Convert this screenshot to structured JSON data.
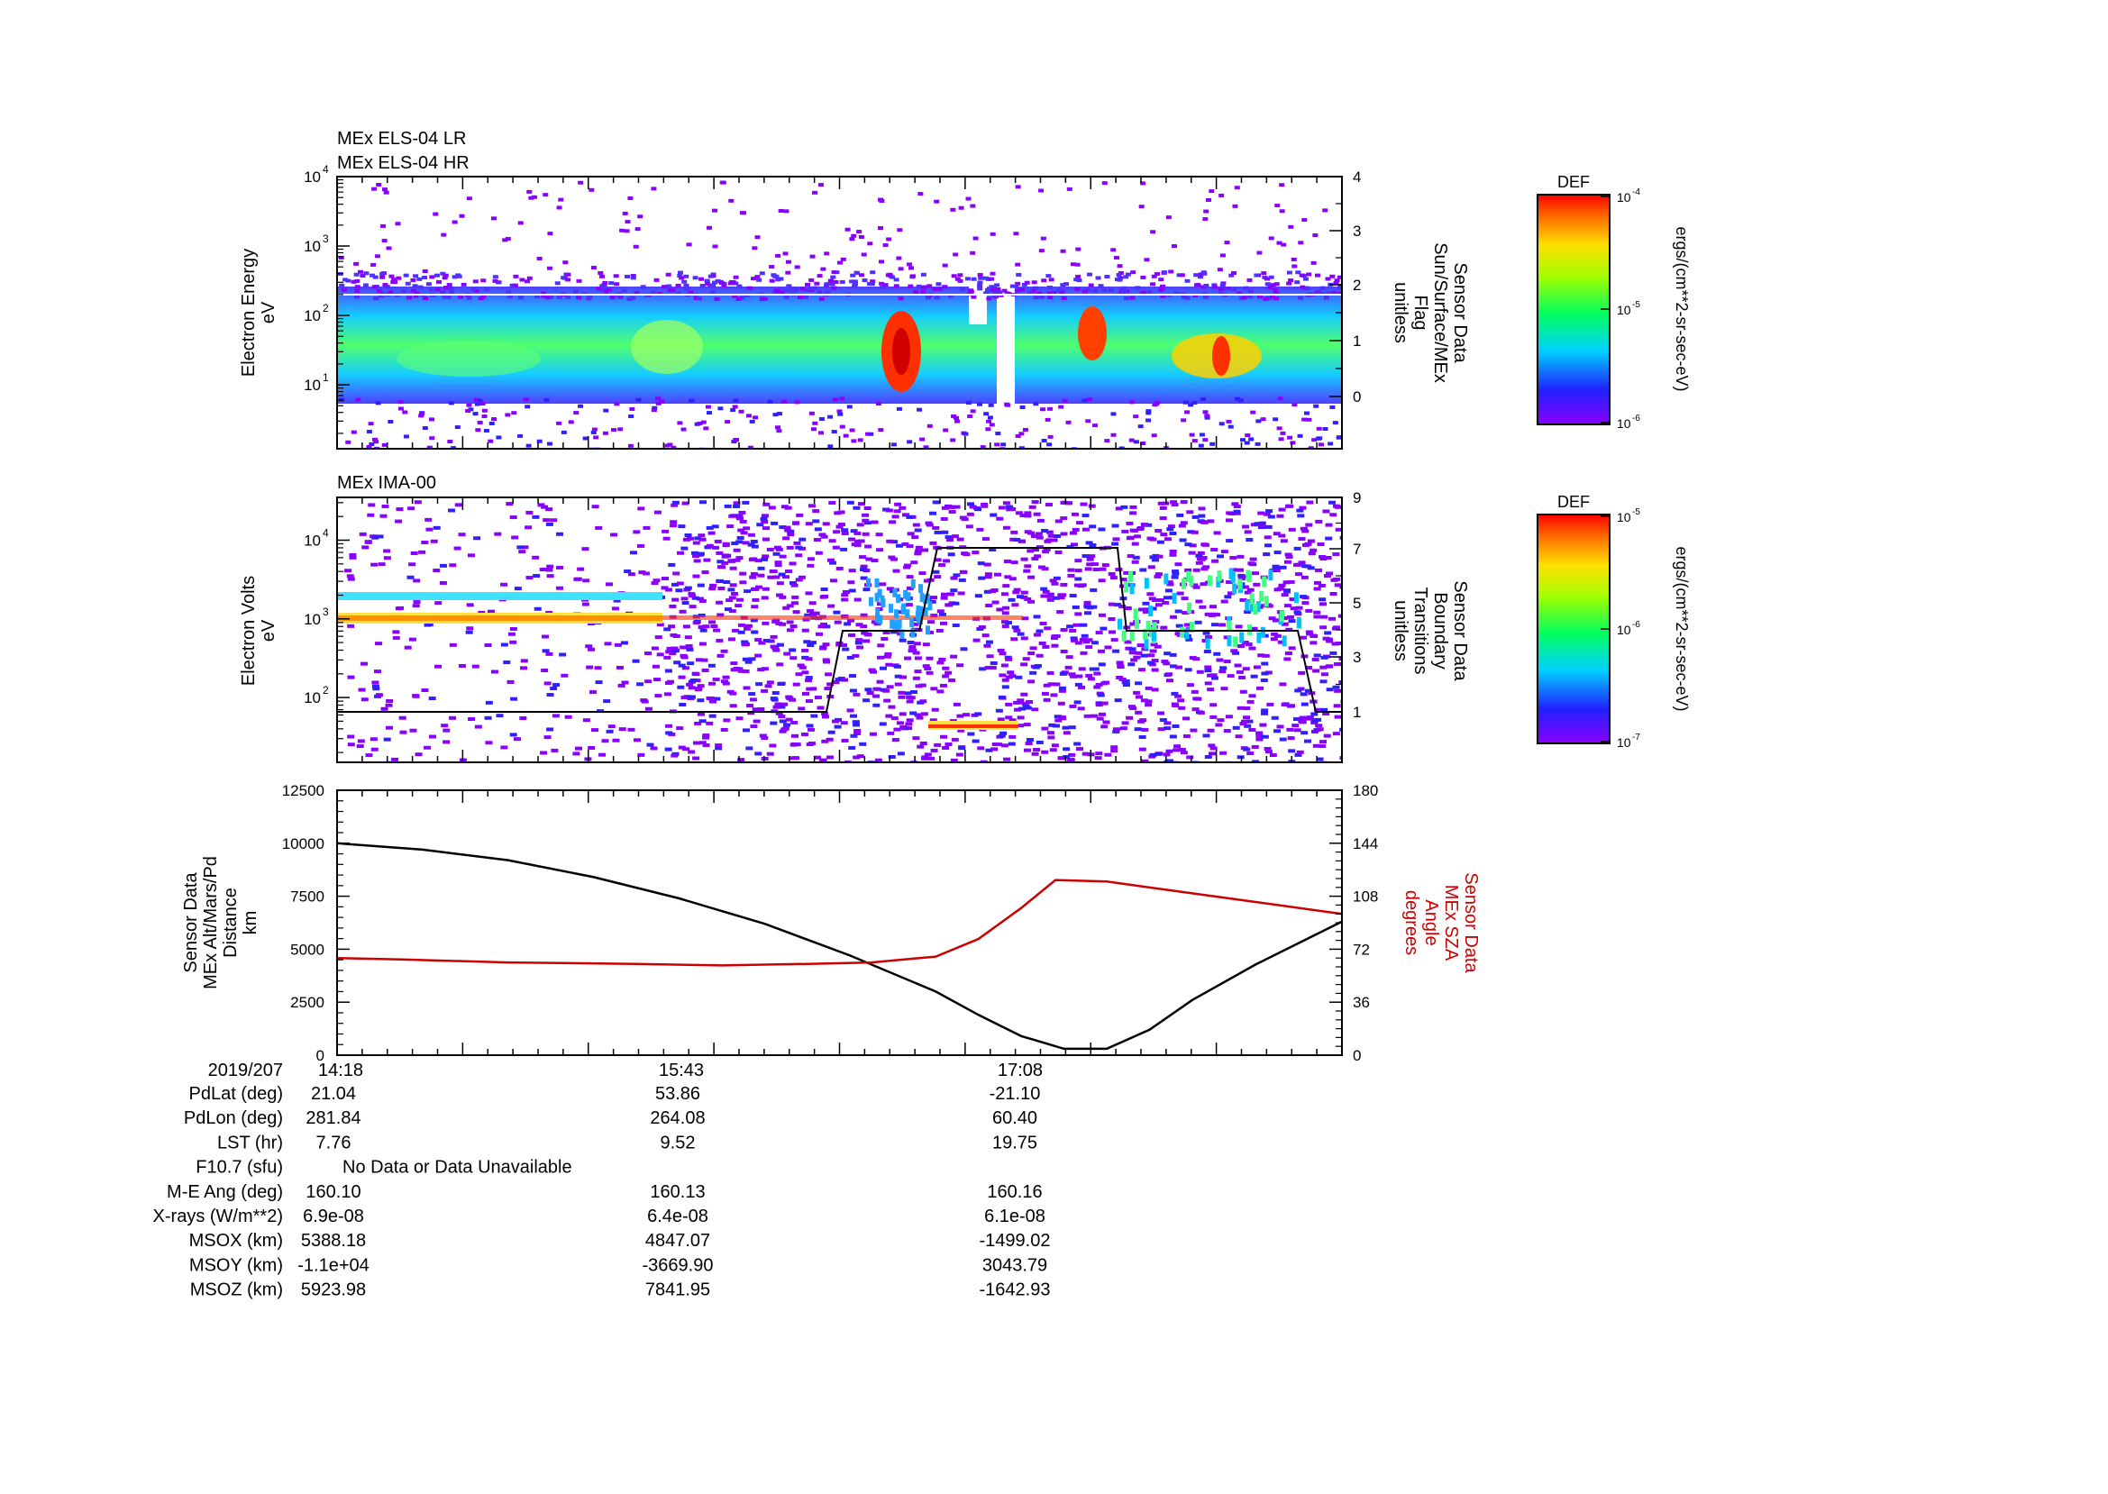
{
  "panel1": {
    "titles": [
      "MEx ELS-04 LR",
      "MEx ELS-04 HR"
    ],
    "ylabel_left": [
      "Electron Energy",
      "eV"
    ],
    "ylabel_right": [
      "Sensor Data",
      "Sun/Surface/MEx",
      "Flag",
      "unitless"
    ],
    "left_ticks": [
      {
        "label": "10",
        "exp": "1",
        "value": 10
      },
      {
        "label": "10",
        "exp": "2",
        "value": 100
      },
      {
        "label": "10",
        "exp": "3",
        "value": 1000
      },
      {
        "label": "10",
        "exp": "4",
        "value": 10000
      }
    ],
    "right_ticks": [
      "0",
      "1",
      "2",
      "3",
      "4"
    ],
    "colorbar": {
      "title": "DEF",
      "unit": "ergs/(cm**2-sr-sec-eV)",
      "ticks": [
        {
          "label": "10",
          "exp": "-4"
        },
        {
          "label": "10",
          "exp": "-5"
        },
        {
          "label": "10",
          "exp": "-6"
        }
      ]
    }
  },
  "panel2": {
    "titles": [
      "MEx IMA-00"
    ],
    "ylabel_left": [
      "Electron Volts",
      "eV"
    ],
    "ylabel_right": [
      "Sensor Data",
      "Boundary",
      "Transitions",
      "unitless"
    ],
    "left_ticks": [
      {
        "label": "10",
        "exp": "2",
        "value": 100
      },
      {
        "label": "10",
        "exp": "3",
        "value": 1000
      },
      {
        "label": "10",
        "exp": "4",
        "value": 10000
      }
    ],
    "right_ticks": [
      "1",
      "3",
      "5",
      "7",
      "9"
    ],
    "colorbar": {
      "title": "DEF",
      "unit": "ergs/(cm**2-sr-sec-eV)",
      "ticks": [
        {
          "label": "10",
          "exp": "-5"
        },
        {
          "label": "10",
          "exp": "-6"
        },
        {
          "label": "10",
          "exp": "-7"
        }
      ]
    }
  },
  "panel3": {
    "ylabel_left": [
      "Sensor Data",
      "MEx Alt/Mars/Pd",
      "Distance",
      "km"
    ],
    "ylabel_right": [
      "Sensor Data",
      "MEx SZA",
      "Angle",
      "degrees"
    ],
    "left_ticks": [
      "0",
      "2500",
      "5000",
      "7500",
      "10000",
      "12500"
    ],
    "right_ticks": [
      "0",
      "36",
      "72",
      "108",
      "144",
      "180"
    ],
    "right_color": "#cc0000"
  },
  "chart_data": {
    "type": "line",
    "x_unit": "minutes after 14:18",
    "xlim": [
      0,
      235
    ],
    "series": [
      {
        "axis": "left",
        "color": "#000000",
        "ylim": [
          0,
          12500
        ],
        "x": [
          0,
          20,
          40,
          60,
          80,
          100,
          120,
          140,
          150,
          160,
          170,
          180,
          190,
          200,
          215,
          235
        ],
        "y": [
          10000,
          9700,
          9200,
          8400,
          7400,
          6200,
          4700,
          3000,
          1900,
          900,
          300,
          300,
          1200,
          2600,
          4300,
          6300
        ]
      },
      {
        "axis": "right",
        "color": "#cc0000",
        "ylim": [
          0,
          180
        ],
        "x": [
          0,
          15,
          40,
          70,
          90,
          110,
          125,
          140,
          150,
          160,
          168,
          180,
          195,
          215,
          235
        ],
        "y": [
          66,
          65,
          63,
          62,
          61,
          62,
          63,
          67,
          79,
          100,
          119,
          118,
          112,
          104,
          96
        ]
      }
    ]
  },
  "time_labels": [
    "14:18",
    "15:43",
    "17:08"
  ],
  "ephemeris": {
    "date": "2019/207",
    "rows": [
      {
        "label": "PdLat (deg)",
        "values": [
          "21.04",
          "53.86",
          "-21.10"
        ]
      },
      {
        "label": "PdLon (deg)",
        "values": [
          "281.84",
          "264.08",
          "60.40"
        ]
      },
      {
        "label": "LST (hr)",
        "values": [
          "7.76",
          "9.52",
          "19.75"
        ]
      },
      {
        "label": "F10.7 (sfu)",
        "note": "No Data or Data Unavailable"
      },
      {
        "label": "M-E Ang (deg)",
        "values": [
          "160.10",
          "160.13",
          "160.16"
        ]
      },
      {
        "label": "X-rays (W/m**2)",
        "values": [
          "6.9e-08",
          "6.4e-08",
          "6.1e-08"
        ]
      },
      {
        "label": "MSOX (km)",
        "values": [
          "5388.18",
          "4847.07",
          "-1499.02"
        ]
      },
      {
        "label": "MSOY (km)",
        "values": [
          "-1.1e+04",
          "-3669.90",
          "3043.79"
        ]
      },
      {
        "label": "MSOZ (km)",
        "values": [
          "5923.98",
          "7841.95",
          "-1642.93"
        ]
      }
    ]
  }
}
